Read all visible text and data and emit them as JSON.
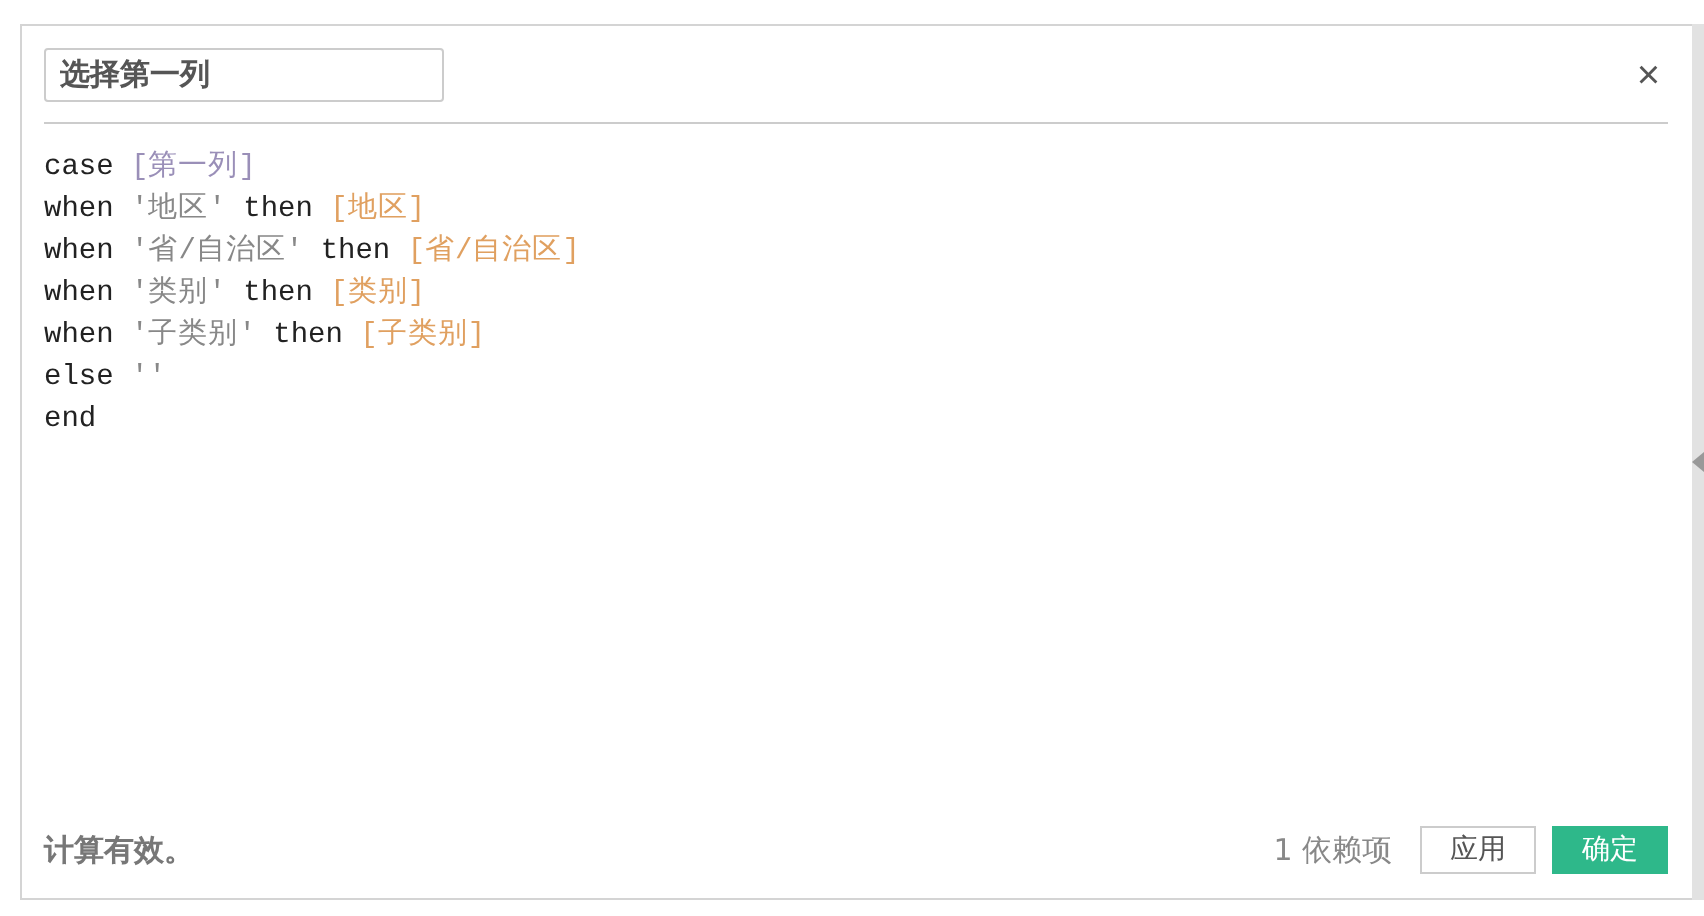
{
  "dialog": {
    "name_field": {
      "value": "选择第一列"
    },
    "close": "×"
  },
  "code_lines": [
    [
      {
        "kind": "keyword",
        "text": "case "
      },
      {
        "kind": "parameter",
        "text": "[第一列]"
      }
    ],
    [
      {
        "kind": "keyword",
        "text": "when "
      },
      {
        "kind": "string",
        "text": "'地区'"
      },
      {
        "kind": "keyword",
        "text": " then "
      },
      {
        "kind": "field",
        "text": "[地区]"
      }
    ],
    [
      {
        "kind": "keyword",
        "text": "when "
      },
      {
        "kind": "string",
        "text": "'省/自治区'"
      },
      {
        "kind": "keyword",
        "text": " then "
      },
      {
        "kind": "field",
        "text": "[省/自治区]"
      }
    ],
    [
      {
        "kind": "keyword",
        "text": "when "
      },
      {
        "kind": "string",
        "text": "'类别'"
      },
      {
        "kind": "keyword",
        "text": " then "
      },
      {
        "kind": "field",
        "text": "[类别]"
      }
    ],
    [
      {
        "kind": "keyword",
        "text": "when "
      },
      {
        "kind": "string",
        "text": "'子类别'"
      },
      {
        "kind": "keyword",
        "text": " then "
      },
      {
        "kind": "field",
        "text": "[子类别]"
      }
    ],
    [
      {
        "kind": "keyword",
        "text": "else "
      },
      {
        "kind": "string",
        "text": "''"
      }
    ],
    [
      {
        "kind": "keyword",
        "text": "end"
      }
    ]
  ],
  "footer": {
    "status": "计算有效。",
    "dependencies": "1 依赖项",
    "buttons": [
      {
        "label": "应用",
        "kind": "secondary"
      },
      {
        "label": "确定",
        "kind": "primary"
      }
    ]
  }
}
